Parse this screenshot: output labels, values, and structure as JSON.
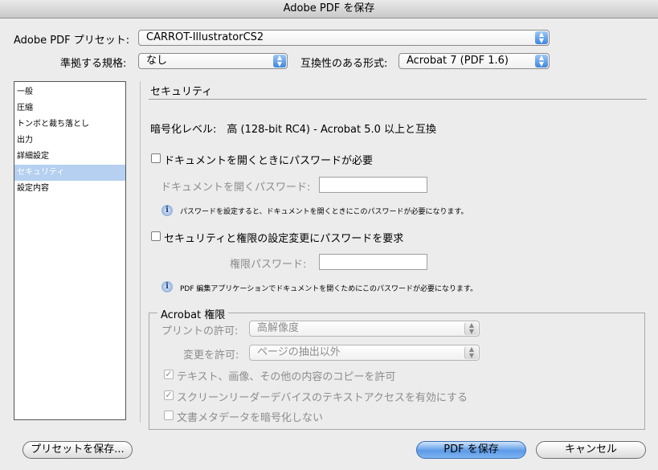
{
  "window": {
    "title": "Adobe PDF を保存"
  },
  "preset": {
    "label": "Adobe PDF プリセット:",
    "value": "CARROT-IllustratorCS2"
  },
  "standard": {
    "label": "準拠する規格:",
    "value": "なし"
  },
  "compat": {
    "label": "互換性のある形式:",
    "value": "Acrobat 7 (PDF 1.6)"
  },
  "sidebar": {
    "items": [
      {
        "label": "一般"
      },
      {
        "label": "圧縮"
      },
      {
        "label": "トンボと裁ち落とし"
      },
      {
        "label": "出力"
      },
      {
        "label": "詳細設定"
      },
      {
        "label": "セキュリティ"
      },
      {
        "label": "設定内容"
      }
    ],
    "selected_index": 5
  },
  "security": {
    "heading": "セキュリティ",
    "encryption": "暗号化レベル:　高 (128-bit RC4) - Acrobat 5.0 以上と互換",
    "open_pw_check": "ドキュメントを開くときにパスワードが必要",
    "open_pw_label": "ドキュメントを開くパスワード:",
    "open_pw_note": "パスワードを設定すると、ドキュメントを開くときにこのパスワードが必要になります。",
    "perm_pw_check": "セキュリティと権限の設定変更にパスワードを要求",
    "perm_pw_label": "権限パスワード:",
    "perm_pw_note": "PDF 編集アプリケーションでドキュメントを開くためにこのパスワードが必要になります。"
  },
  "acrobat": {
    "group_title": "Acrobat 権限",
    "print_label": "プリントの許可:",
    "print_value": "高解像度",
    "change_label": "変更を許可:",
    "change_value": "ページの抽出以外",
    "copy_check": "テキスト、画像、その他の内容のコピーを許可",
    "screenreader_check": "スクリーンリーダーデバイスのテキストアクセスを有効にする",
    "metadata_check": "文書メタデータを暗号化しない"
  },
  "buttons": {
    "save_preset": "プリセットを保存...",
    "save_pdf": "PDF を保存",
    "cancel": "キャンセル"
  },
  "colors": {
    "accent": "#5c9be8",
    "selection": "#b5d0f0"
  }
}
